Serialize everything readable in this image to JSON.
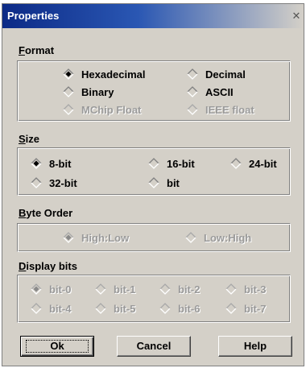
{
  "window": {
    "title": "Properties",
    "close_glyph": "✕"
  },
  "format": {
    "title_u": "F",
    "title_rest": "ormat",
    "options": [
      {
        "label": "Hexadecimal",
        "selected": true,
        "enabled": true
      },
      {
        "label": "Decimal",
        "selected": false,
        "enabled": true
      },
      {
        "label": "Binary",
        "selected": false,
        "enabled": true
      },
      {
        "label": "ASCII",
        "selected": false,
        "enabled": true
      },
      {
        "label": "MChip Float",
        "selected": false,
        "enabled": false
      },
      {
        "label": "IEEE float",
        "selected": false,
        "enabled": false
      }
    ]
  },
  "size": {
    "title_u": "S",
    "title_rest": "ize",
    "options": [
      {
        "label": "8-bit",
        "selected": true,
        "enabled": true
      },
      {
        "label": "16-bit",
        "selected": false,
        "enabled": true
      },
      {
        "label": "24-bit",
        "selected": false,
        "enabled": true
      },
      {
        "label": "32-bit",
        "selected": false,
        "enabled": true
      },
      {
        "label": "bit",
        "selected": false,
        "enabled": true
      }
    ]
  },
  "byte_order": {
    "title_u": "B",
    "title_rest": "yte Order",
    "options": [
      {
        "label": "High:Low",
        "selected": true,
        "enabled": false
      },
      {
        "label": "Low:High",
        "selected": false,
        "enabled": false
      }
    ]
  },
  "display_bits": {
    "title_u": "D",
    "title_rest": "isplay bits",
    "options": [
      {
        "label": "bit-0",
        "selected": true,
        "enabled": false
      },
      {
        "label": "bit-1",
        "selected": false,
        "enabled": false
      },
      {
        "label": "bit-2",
        "selected": false,
        "enabled": false
      },
      {
        "label": "bit-3",
        "selected": false,
        "enabled": false
      },
      {
        "label": "bit-4",
        "selected": false,
        "enabled": false
      },
      {
        "label": "bit-5",
        "selected": false,
        "enabled": false
      },
      {
        "label": "bit-6",
        "selected": false,
        "enabled": false
      },
      {
        "label": "bit-7",
        "selected": false,
        "enabled": false
      }
    ]
  },
  "buttons": {
    "ok": "Ok",
    "cancel": "Cancel",
    "help": "Help"
  },
  "colors": {
    "face": "#d4d0c8",
    "title_start": "#0c2a86",
    "disabled_text": "#9a9a9a"
  }
}
